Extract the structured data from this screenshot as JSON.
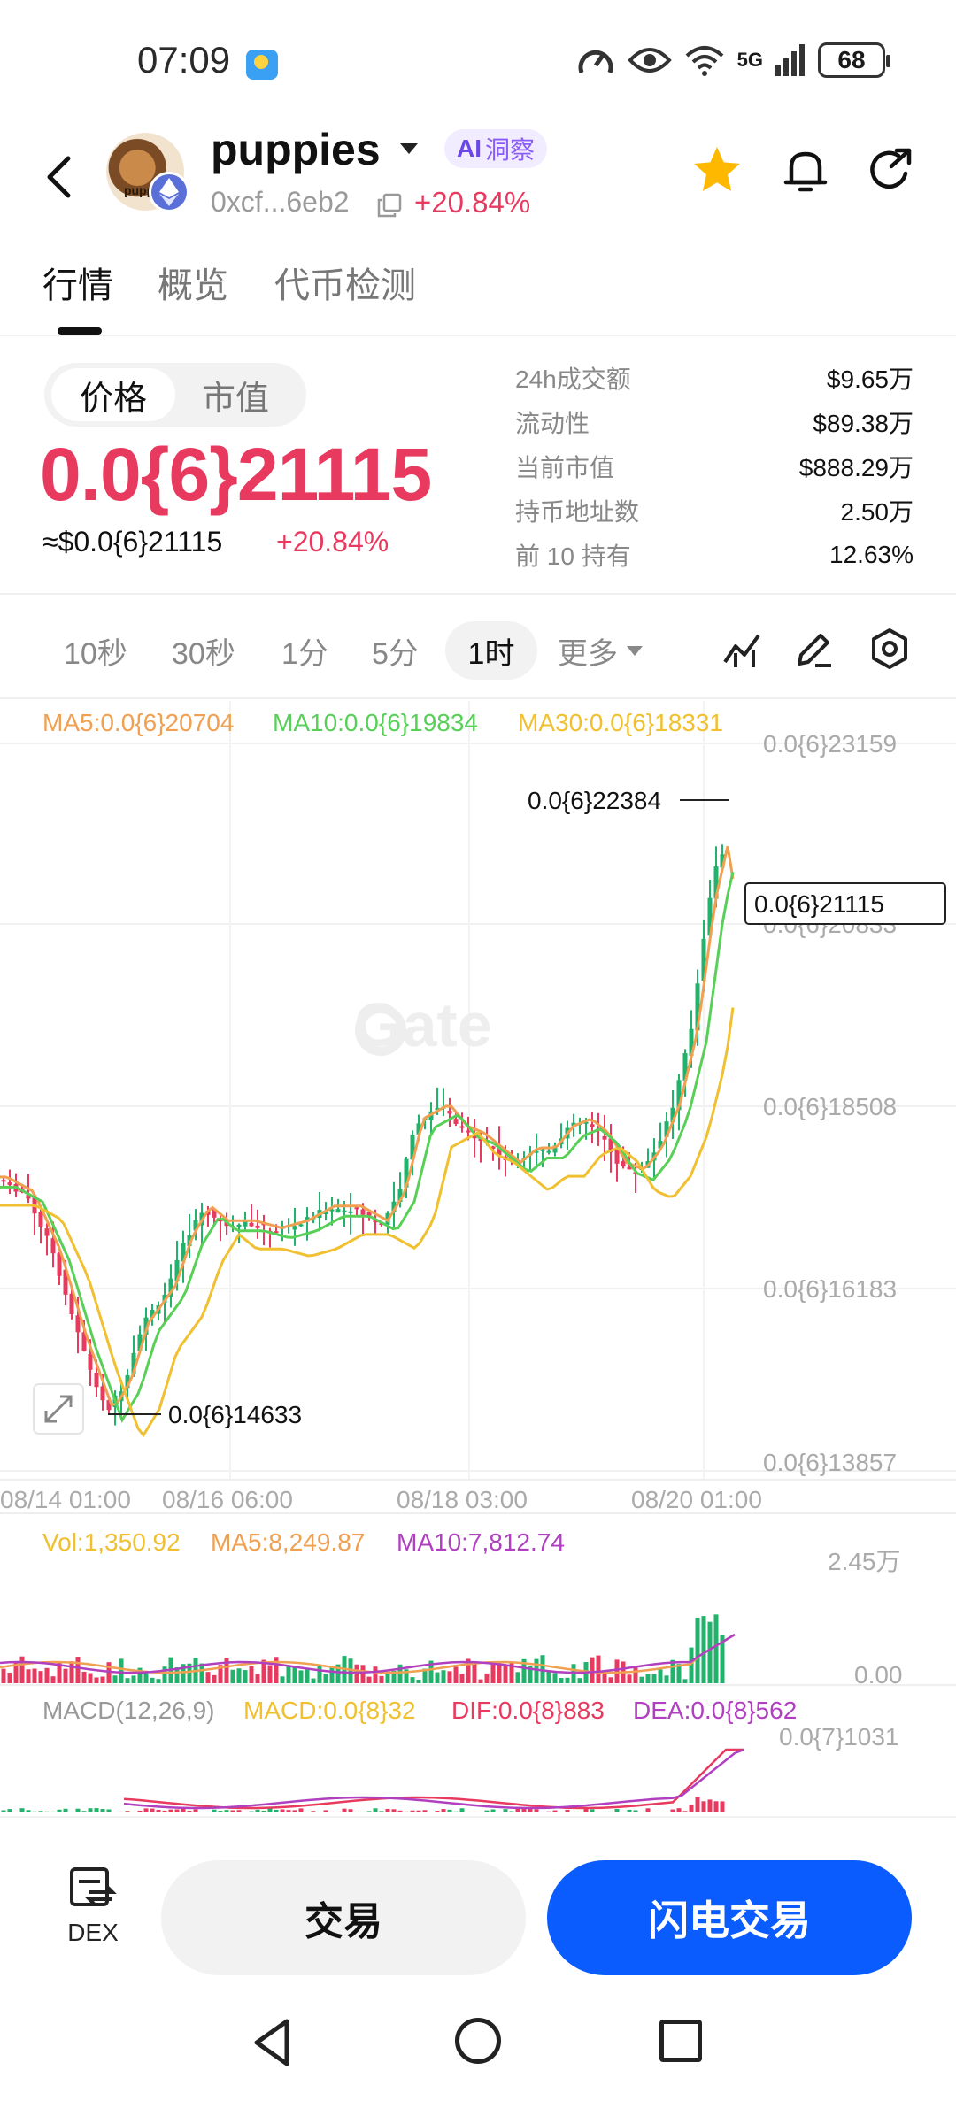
{
  "status_bar": {
    "time": "07:09",
    "network": "5G",
    "battery": "68"
  },
  "header": {
    "token_name": "puppies",
    "ai_badge_prefix": "AI",
    "ai_badge_label": "洞察",
    "address": "0xcf...6eb2",
    "change": "+20.84%",
    "logo_label": "puppi"
  },
  "tabs": [
    "行情",
    "概览",
    "代币检测"
  ],
  "price_panel": {
    "toggle": [
      "价格",
      "市值"
    ],
    "price": "0.0{6}21115",
    "usd_price": "≈$0.0{6}21115",
    "change": "+20.84%",
    "stats": [
      {
        "label": "24h成交额",
        "value": "$9.65万"
      },
      {
        "label": "流动性",
        "value": "$89.38万"
      },
      {
        "label": "当前市值",
        "value": "$888.29万"
      },
      {
        "label": "持币地址数",
        "value": "2.50万"
      },
      {
        "label": "前 10 持有",
        "value": "12.63%"
      }
    ]
  },
  "intervals": [
    "10秒",
    "30秒",
    "1分",
    "5分",
    "1时",
    "更多"
  ],
  "active_interval": "1时",
  "chart": {
    "ma_legend": [
      {
        "text": "MA5:0.0{6}20704",
        "color": "#f0a050"
      },
      {
        "text": "MA10:0.0{6}19834",
        "color": "#58d058"
      },
      {
        "text": "MA30:0.0{6}18331",
        "color": "#f0c030"
      }
    ],
    "price_ticks": [
      "0.0{6}23159",
      "0.0{6}20833",
      "0.0{6}18508",
      "0.0{6}16183",
      "0.0{6}13857"
    ],
    "high_label": "0.0{6}22384",
    "low_label": "0.0{6}14633",
    "current_label": "0.0{6}21115",
    "watermark": "Gate",
    "date_ticks": [
      "08/14 01:00",
      "08/16 06:00",
      "08/18 03:00",
      "08/20 01:00"
    ],
    "volume_legend": [
      {
        "text": "Vol:1,350.92",
        "color": "#f0c030"
      },
      {
        "text": "MA5:8,249.87",
        "color": "#f0a050"
      },
      {
        "text": "MA10:7,812.74",
        "color": "#b040c0"
      }
    ],
    "volume_ticks": [
      "2.45万",
      "0.00"
    ],
    "macd_legend": [
      {
        "text": "MACD(12,26,9)",
        "color": "#999999"
      },
      {
        "text": "MACD:0.0{8}32",
        "color": "#f0c030"
      },
      {
        "text": "DIF:0.0{8}883",
        "color": "#e8395f"
      },
      {
        "text": "DEA:0.0{8}562",
        "color": "#b040c0"
      }
    ],
    "macd_tick": "0.0{7}1031",
    "up_color": "#21b26b",
    "down_color": "#e8395f"
  },
  "chart_data": {
    "type": "candlestick",
    "interval": "1时",
    "price_axis": {
      "min": "0.0{6}13857",
      "max": "0.0{6}23159"
    },
    "x": [
      "08/14 01:00",
      "08/16 06:00",
      "08/18 03:00",
      "08/20 01:00"
    ],
    "high": "0.0{6}22384",
    "low": "0.0{6}14633",
    "last": "0.0{6}21115"
  },
  "bottom_bar": {
    "dex_label": "DEX",
    "trade_label": "交易",
    "flash_trade_label": "闪电交易"
  }
}
